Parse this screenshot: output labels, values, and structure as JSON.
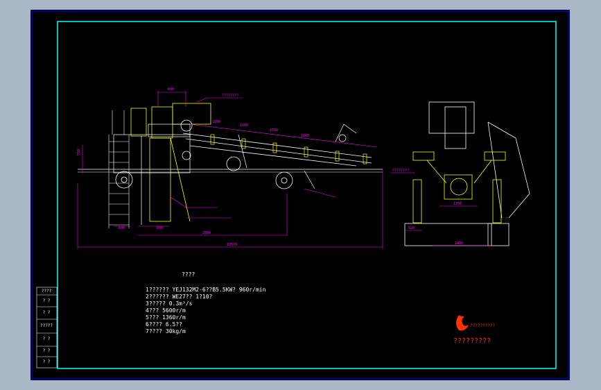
{
  "drawing": {
    "notes_title": "????",
    "notes": [
      "1?????? YEJ132M2-6??B5.5KW? 960r/min",
      "2?????? WE27??  1?10?",
      "3?????   0.3m³/s",
      "4???   5600r/m",
      "5???   1360r/m",
      "6????   6.5??",
      "7????   30kg/m"
    ],
    "side_view_dims": {
      "d800": "800",
      "d1200": "1200",
      "d1500": "1500",
      "d1800a": "1800",
      "d1800b": "1800",
      "d600": "600",
      "d800b": "800",
      "d2800": "2800",
      "d10570": "10570",
      "leader": "????????",
      "left": "550"
    },
    "end_view_dims": {
      "d1350": "1350",
      "d520": "520",
      "d2400": "2400",
      "leader": "????????"
    },
    "logo_text": "??????????",
    "logo_caption": "?????????",
    "title_block": [
      "????",
      "? ?",
      "? ?",
      "?????",
      "? ?",
      "? ?",
      "? ?"
    ]
  },
  "colors": {
    "frame_blue": "#0000ff",
    "inner_border": "#00ffff",
    "dimension": "#ff00ff",
    "outline_yellow": "#ffff00",
    "logo_red": "#ff3300"
  }
}
